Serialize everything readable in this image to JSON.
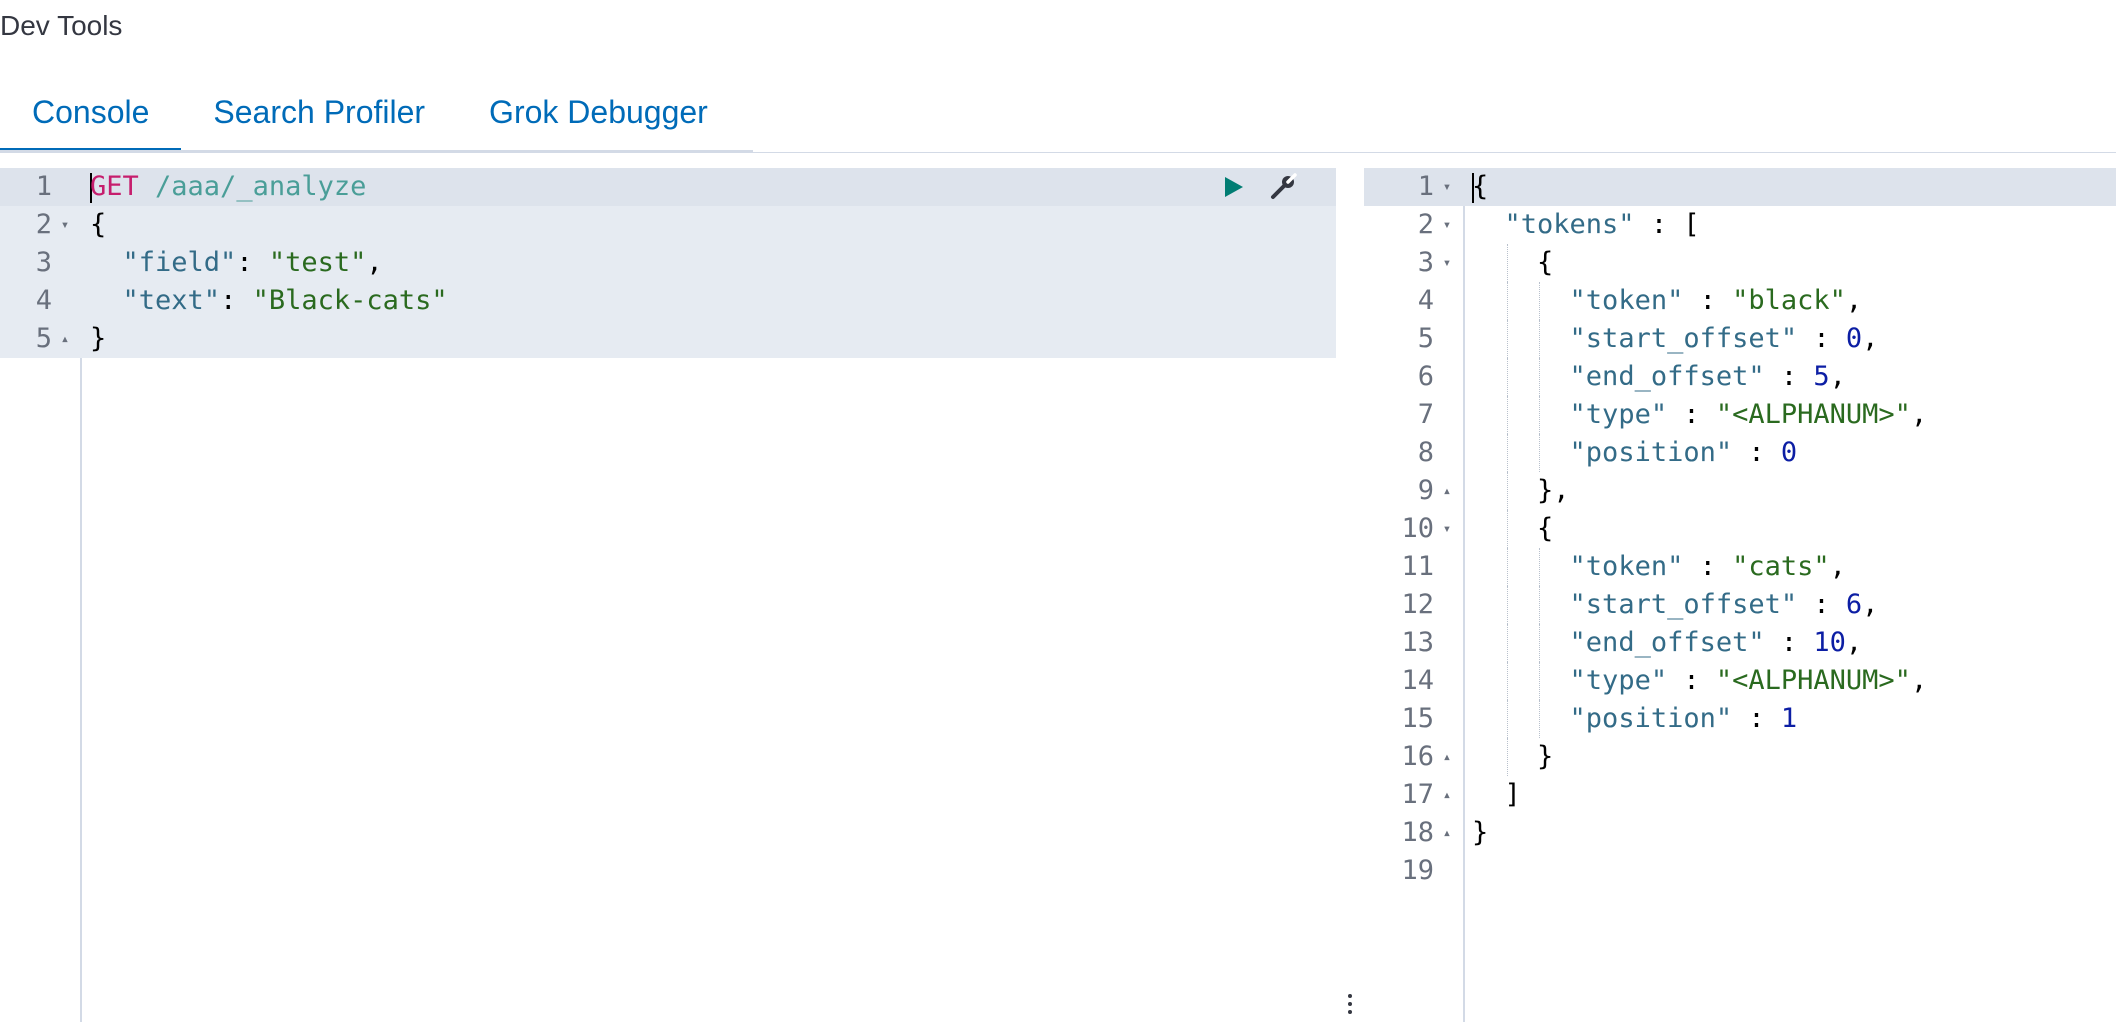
{
  "app": {
    "title": "Dev Tools"
  },
  "tabs": [
    {
      "label": "Console",
      "active": true
    },
    {
      "label": "Search Profiler",
      "active": false
    },
    {
      "label": "Grok Debugger",
      "active": false
    }
  ],
  "request_editor": {
    "lines": [
      {
        "number": "1",
        "fold": "",
        "tokens": [
          {
            "t": "GET",
            "c": "method"
          },
          {
            "t": " /aaa/_analyze",
            "c": "url"
          }
        ]
      },
      {
        "number": "2",
        "fold": "▾",
        "tokens": [
          {
            "t": "{",
            "c": "punc"
          }
        ]
      },
      {
        "number": "3",
        "fold": "",
        "tokens": [
          {
            "t": "  ",
            "c": "punc"
          },
          {
            "t": "\"field\"",
            "c": "key"
          },
          {
            "t": ": ",
            "c": "punc"
          },
          {
            "t": "\"test\"",
            "c": "str"
          },
          {
            "t": ",",
            "c": "punc"
          }
        ]
      },
      {
        "number": "4",
        "fold": "",
        "tokens": [
          {
            "t": "  ",
            "c": "punc"
          },
          {
            "t": "\"text\"",
            "c": "key"
          },
          {
            "t": ": ",
            "c": "punc"
          },
          {
            "t": "\"Black-cats\"",
            "c": "str"
          }
        ]
      },
      {
        "number": "5",
        "fold": "▴",
        "tokens": [
          {
            "t": "}",
            "c": "punc"
          }
        ]
      }
    ]
  },
  "request_actions": {
    "play_icon": "play-icon",
    "wrench_icon": "wrench-icon"
  },
  "response_editor": {
    "lines": [
      {
        "number": "1",
        "fold": "▾",
        "guides": 0,
        "tokens": [
          {
            "t": "{",
            "c": "punc"
          }
        ]
      },
      {
        "number": "2",
        "fold": "▾",
        "guides": 0,
        "tokens": [
          {
            "t": "  ",
            "c": "punc"
          },
          {
            "t": "\"tokens\"",
            "c": "key"
          },
          {
            "t": " : [",
            "c": "punc"
          }
        ]
      },
      {
        "number": "3",
        "fold": "▾",
        "guides": 1,
        "tokens": [
          {
            "t": "{",
            "c": "punc"
          }
        ]
      },
      {
        "number": "4",
        "fold": "",
        "guides": 2,
        "tokens": [
          {
            "t": "\"token\"",
            "c": "key"
          },
          {
            "t": " : ",
            "c": "punc"
          },
          {
            "t": "\"black\"",
            "c": "str"
          },
          {
            "t": ",",
            "c": "punc"
          }
        ]
      },
      {
        "number": "5",
        "fold": "",
        "guides": 2,
        "tokens": [
          {
            "t": "\"start_offset\"",
            "c": "key"
          },
          {
            "t": " : ",
            "c": "punc"
          },
          {
            "t": "0",
            "c": "num"
          },
          {
            "t": ",",
            "c": "punc"
          }
        ]
      },
      {
        "number": "6",
        "fold": "",
        "guides": 2,
        "tokens": [
          {
            "t": "\"end_offset\"",
            "c": "key"
          },
          {
            "t": " : ",
            "c": "punc"
          },
          {
            "t": "5",
            "c": "num"
          },
          {
            "t": ",",
            "c": "punc"
          }
        ]
      },
      {
        "number": "7",
        "fold": "",
        "guides": 2,
        "tokens": [
          {
            "t": "\"type\"",
            "c": "key"
          },
          {
            "t": " : ",
            "c": "punc"
          },
          {
            "t": "\"<ALPHANUM>\"",
            "c": "str"
          },
          {
            "t": ",",
            "c": "punc"
          }
        ]
      },
      {
        "number": "8",
        "fold": "",
        "guides": 2,
        "tokens": [
          {
            "t": "\"position\"",
            "c": "key"
          },
          {
            "t": " : ",
            "c": "punc"
          },
          {
            "t": "0",
            "c": "num"
          }
        ]
      },
      {
        "number": "9",
        "fold": "▴",
        "guides": 1,
        "tokens": [
          {
            "t": "},",
            "c": "punc"
          }
        ]
      },
      {
        "number": "10",
        "fold": "▾",
        "guides": 1,
        "tokens": [
          {
            "t": "{",
            "c": "punc"
          }
        ]
      },
      {
        "number": "11",
        "fold": "",
        "guides": 2,
        "tokens": [
          {
            "t": "\"token\"",
            "c": "key"
          },
          {
            "t": " : ",
            "c": "punc"
          },
          {
            "t": "\"cats\"",
            "c": "str"
          },
          {
            "t": ",",
            "c": "punc"
          }
        ]
      },
      {
        "number": "12",
        "fold": "",
        "guides": 2,
        "tokens": [
          {
            "t": "\"start_offset\"",
            "c": "key"
          },
          {
            "t": " : ",
            "c": "punc"
          },
          {
            "t": "6",
            "c": "num"
          },
          {
            "t": ",",
            "c": "punc"
          }
        ]
      },
      {
        "number": "13",
        "fold": "",
        "guides": 2,
        "tokens": [
          {
            "t": "\"end_offset\"",
            "c": "key"
          },
          {
            "t": " : ",
            "c": "punc"
          },
          {
            "t": "10",
            "c": "num"
          },
          {
            "t": ",",
            "c": "punc"
          }
        ]
      },
      {
        "number": "14",
        "fold": "",
        "guides": 2,
        "tokens": [
          {
            "t": "\"type\"",
            "c": "key"
          },
          {
            "t": " : ",
            "c": "punc"
          },
          {
            "t": "\"<ALPHANUM>\"",
            "c": "str"
          },
          {
            "t": ",",
            "c": "punc"
          }
        ]
      },
      {
        "number": "15",
        "fold": "",
        "guides": 2,
        "tokens": [
          {
            "t": "\"position\"",
            "c": "key"
          },
          {
            "t": " : ",
            "c": "punc"
          },
          {
            "t": "1",
            "c": "num"
          }
        ]
      },
      {
        "number": "16",
        "fold": "▴",
        "guides": 1,
        "tokens": [
          {
            "t": "}",
            "c": "punc"
          }
        ]
      },
      {
        "number": "17",
        "fold": "▴",
        "guides": 0,
        "tokens": [
          {
            "t": "  ]",
            "c": "punc"
          }
        ]
      },
      {
        "number": "18",
        "fold": "▴",
        "guides": 0,
        "tokens": [
          {
            "t": "}",
            "c": "punc"
          }
        ]
      },
      {
        "number": "19",
        "fold": "",
        "guides": 0,
        "tokens": []
      }
    ]
  },
  "colors": {
    "accent": "#006bb8",
    "method": "#c61e6d",
    "url": "#4a9e98",
    "key": "#336b87",
    "string": "#2a6a1f",
    "number": "#0c1ea4",
    "play": "#017d73"
  }
}
